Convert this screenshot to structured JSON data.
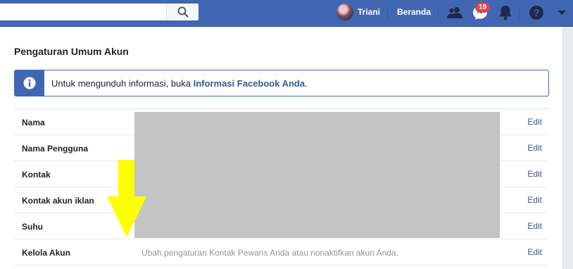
{
  "topbar": {
    "search_placeholder": "",
    "user_name": "Triani",
    "home_label": "Beranda",
    "message_badge": "19",
    "icons": [
      "search-icon",
      "friend-requests-icon",
      "messenger-icon",
      "notifications-icon",
      "help-icon",
      "account-menu-icon"
    ]
  },
  "page": {
    "title": "Pengaturan Umum Akun",
    "info": {
      "text_before": "Untuk mengunduh informasi, buka ",
      "link": "Informasi Facebook Anda",
      "text_after": "."
    }
  },
  "settings": {
    "edit_label": "Edit",
    "rows": [
      {
        "label": "Nama",
        "value": ""
      },
      {
        "label": "Nama Pengguna",
        "value": ""
      },
      {
        "label": "Kontak",
        "value": ""
      },
      {
        "label": "Kontak akun iklan",
        "value": ""
      },
      {
        "label": "Suhu",
        "value": ""
      },
      {
        "label": "Kelola Akun",
        "value": "Ubah pengaturan Kontak Pewaris Anda atau nonaktifkan akun Anda."
      }
    ]
  },
  "colors": {
    "brand_blue": "#4267b2",
    "link_blue": "#365899",
    "badge_red": "#fa3e3e",
    "annotation_arrow": "#ffff00",
    "redaction_gray": "#c4c4c4"
  }
}
